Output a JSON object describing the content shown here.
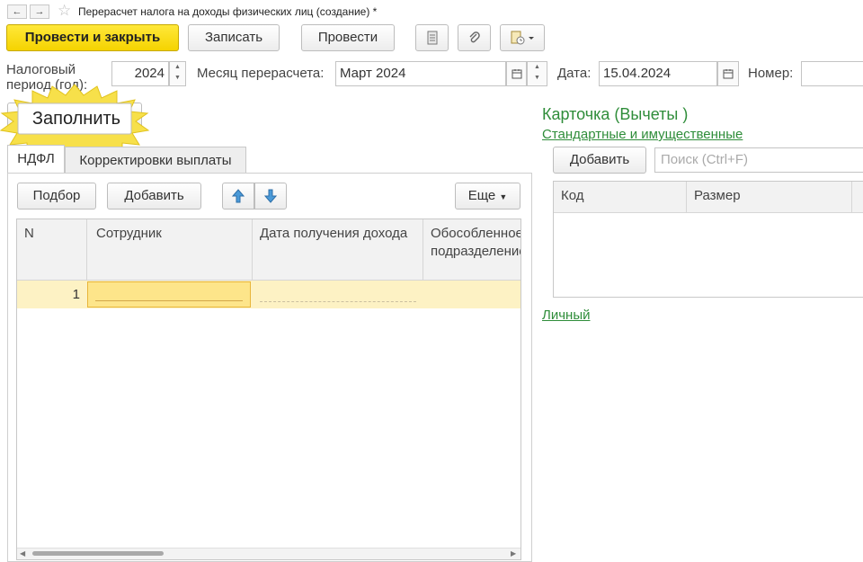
{
  "window": {
    "title": "Перерасчет налога на доходы физических лиц (создание) *",
    "back_glyph": "←",
    "forward_glyph": "→",
    "star_glyph": "☆"
  },
  "toolbar": {
    "post_close_label": "Провести и закрыть",
    "save_label": "Записать",
    "post_label": "Провести"
  },
  "header": {
    "tax_period_label": "Налоговый период (год):",
    "tax_period_value": "2024",
    "month_label": "Месяц перерасчета:",
    "month_value": "Март 2024",
    "date_label": "Дата:",
    "date_value": "15.04.2024",
    "number_label": "Номер:",
    "number_value": ""
  },
  "fill_button": {
    "label": "Заполнить"
  },
  "tabs": [
    {
      "label": "НДФЛ"
    },
    {
      "label": "Корректировки выплаты"
    }
  ],
  "table_toolbar": {
    "select_label": "Подбор",
    "add_label": "Добавить",
    "more_label": "Еще"
  },
  "table": {
    "columns": [
      "N",
      "Сотрудник",
      "Дата получения дохода",
      "Обособленное подразделение"
    ],
    "rows": [
      {
        "n": "1",
        "employee": "",
        "income_date": "",
        "division": ""
      }
    ]
  },
  "right_panel": {
    "card_title": "Карточка (Вычеты )",
    "standard_link": "Стандартные и имущественные",
    "add_label": "Добавить",
    "search_placeholder": "Поиск (Ctrl+F)",
    "columns": [
      "Код",
      "Размер"
    ],
    "personal_link": "Личный"
  },
  "colors": {
    "accent_yellow": "#f5d300",
    "link_green": "#2f8d3a",
    "row_highlight": "#fdf2c4",
    "callout": "#f7e04a"
  }
}
